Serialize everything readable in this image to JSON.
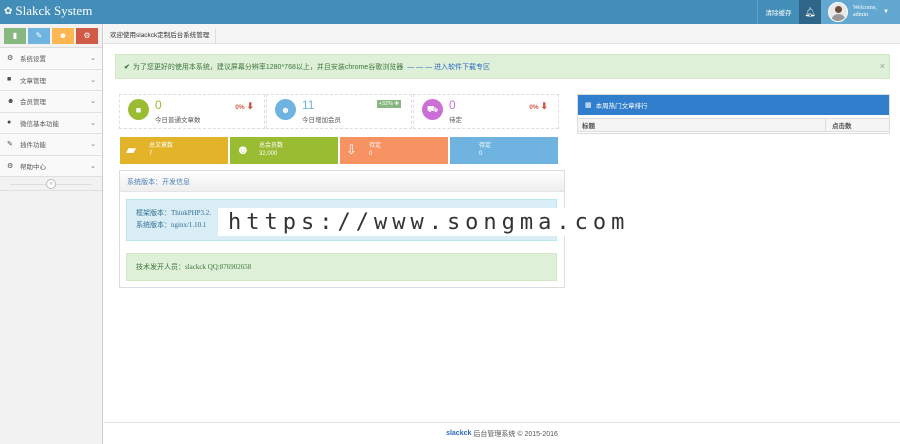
{
  "app": {
    "title": "Slakck System"
  },
  "header": {
    "clear_cache": "清除缓存",
    "welcome": "Welcome,",
    "username": "admin"
  },
  "shortcuts": [
    {
      "icon": "chart-icon",
      "color": "#87b87f"
    },
    {
      "icon": "pencil-icon",
      "color": "#6fb3e0"
    },
    {
      "icon": "users-icon",
      "color": "#ffb752"
    },
    {
      "icon": "cogs-icon",
      "color": "#d15b47"
    }
  ],
  "sidebar": {
    "items": [
      {
        "label": "系统设置",
        "icon": "gear-icon"
      },
      {
        "label": "文章管理",
        "icon": "folder-icon"
      },
      {
        "label": "会员管理",
        "icon": "users-icon"
      },
      {
        "label": "微信基本功能",
        "icon": "wechat-icon"
      },
      {
        "label": "插件功能",
        "icon": "wrench-icon"
      },
      {
        "label": "帮助中心",
        "icon": "cogs-icon"
      }
    ]
  },
  "breadcrumb": {
    "text": "欢迎使用slackck定制后台系统管理"
  },
  "alert": {
    "text": "为了您更好的使用本系统，建议屏幕分辨率1280*768以上，并且安装chrome谷歌浏览器",
    "link": "— — — 进入软件下载专区",
    "close": "×"
  },
  "stats": [
    {
      "value": "0",
      "label": "今日普通文章数",
      "pct": "0%",
      "icon": "folder-icon",
      "color": "#9abc32"
    },
    {
      "value": "11",
      "label": "今日增加会员",
      "badge": "+32% ✚",
      "icon": "user-icon",
      "color": "#6fb3e0"
    },
    {
      "value": "0",
      "label": "待定",
      "pct": "0%",
      "icon": "cart-icon",
      "color": "#cb6fd7"
    }
  ],
  "tiles": [
    {
      "title": "总文章数",
      "value": "7",
      "icon": "book-icon",
      "color": "#e3b42a"
    },
    {
      "title": "总会员数",
      "value": "32,000",
      "icon": "group-icon",
      "color": "#9abc32"
    },
    {
      "title": "待定",
      "value": "0",
      "icon": "download-icon",
      "color": "#f79263"
    },
    {
      "title": "待定",
      "value": "0",
      "icon": "",
      "color": "#6fb3e0"
    }
  ],
  "info": {
    "header": "系统版本：开发信息",
    "framework": "框架版本：ThinkPHP3.2.",
    "system": "系统版本：nginx/1.10.1",
    "dev": "技术发开人员：slackck QQ:876902658"
  },
  "hot": {
    "title": "本周热门文章排行",
    "col_title": "标题",
    "col_clicks": "点击数"
  },
  "watermark": "https://www.songma.com",
  "footer": {
    "brand": "slackck",
    "text": "后台管理系统 © 2015-2016"
  }
}
